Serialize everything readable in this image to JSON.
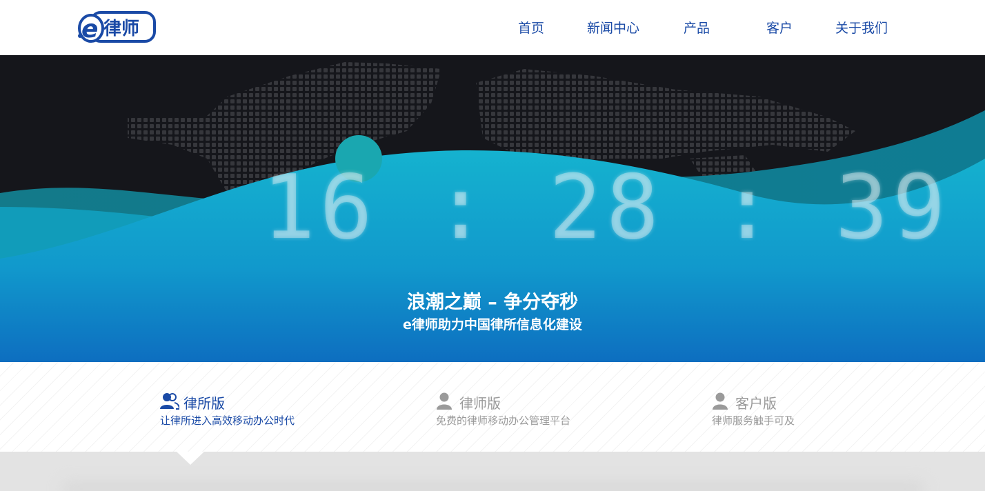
{
  "header": {
    "logo_text": "e律师",
    "nav": [
      {
        "label": "首页"
      },
      {
        "label": "新闻中心"
      },
      {
        "label": "产品"
      },
      {
        "label": "客户"
      },
      {
        "label": "关于我们"
      }
    ]
  },
  "hero": {
    "clock": "16 : 28 : 39",
    "title": "浪潮之巅 – 争分夺秒",
    "subtitle": "e律师助力中国律所信息化建设"
  },
  "tabs": [
    {
      "title": "律所版",
      "subtitle": "让律所进入高效移动办公时代",
      "icon": "users-icon",
      "active": true
    },
    {
      "title": "律师版",
      "subtitle": "免费的律师移动办公管理平台",
      "icon": "user-icon",
      "active": false
    },
    {
      "title": "客户版",
      "subtitle": "律师服务触手可及",
      "icon": "user-icon",
      "active": false
    }
  ],
  "colors": {
    "brand": "#1a4aa6",
    "hero_dark": "#15161b",
    "wave_teal": "#14a7c4",
    "wave_blue": "#0f6fbf",
    "inactive_text": "#9a9a9a"
  }
}
